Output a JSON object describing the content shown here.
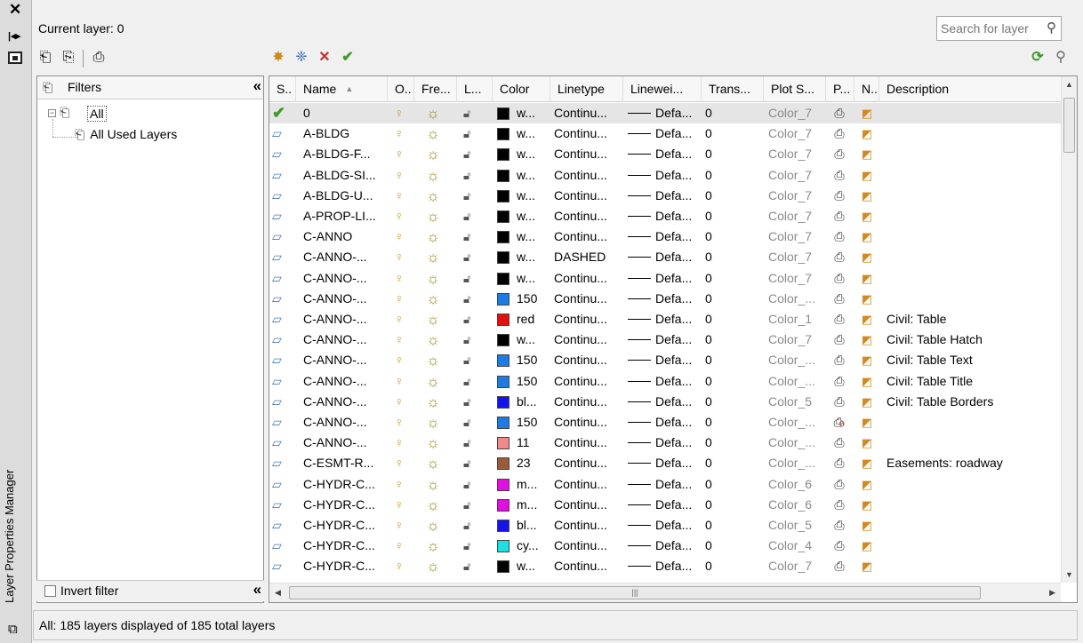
{
  "window": {
    "title": "Layer Properties Manager"
  },
  "header": {
    "current_layer": "Current layer: 0",
    "search_placeholder": "Search for layer"
  },
  "filters": {
    "title": "Filters",
    "tree": [
      {
        "label": "All"
      },
      {
        "label": "All Used Layers"
      }
    ],
    "invert_filter": "Invert filter"
  },
  "columns": [
    "S..",
    "Name",
    "O..",
    "Fre...",
    "L...",
    "Color",
    "Linetype",
    "Linewei...",
    "Trans...",
    "Plot S...",
    "P...",
    "N..",
    "Description"
  ],
  "colors": {
    "white": "#000000",
    "c150": "#1e7be0",
    "red": "#e01010",
    "blue": "#1414e6",
    "c11": "#f08a8a",
    "c23": "#9a5b3c",
    "magenta": "#e010e0",
    "cyan": "#1ee0e0"
  },
  "rows": [
    {
      "current": true,
      "name": "0",
      "swatch": "#000000",
      "color": "w...",
      "linetype": "Continu...",
      "lineweight": "Defa...",
      "trans": "0",
      "plotstyle": "Color_7",
      "print": true,
      "desc": ""
    },
    {
      "name": "A-BLDG",
      "swatch": "#000000",
      "color": "w...",
      "linetype": "Continu...",
      "lineweight": "Defa...",
      "trans": "0",
      "plotstyle": "Color_7",
      "print": true,
      "desc": ""
    },
    {
      "name": "A-BLDG-F...",
      "swatch": "#000000",
      "color": "w...",
      "linetype": "Continu...",
      "lineweight": "Defa...",
      "trans": "0",
      "plotstyle": "Color_7",
      "print": true,
      "desc": ""
    },
    {
      "name": "A-BLDG-SI...",
      "swatch": "#000000",
      "color": "w...",
      "linetype": "Continu...",
      "lineweight": "Defa...",
      "trans": "0",
      "plotstyle": "Color_7",
      "print": true,
      "desc": ""
    },
    {
      "name": "A-BLDG-U...",
      "swatch": "#000000",
      "color": "w...",
      "linetype": "Continu...",
      "lineweight": "Defa...",
      "trans": "0",
      "plotstyle": "Color_7",
      "print": true,
      "desc": ""
    },
    {
      "name": "A-PROP-LI...",
      "swatch": "#000000",
      "color": "w...",
      "linetype": "Continu...",
      "lineweight": "Defa...",
      "trans": "0",
      "plotstyle": "Color_7",
      "print": true,
      "desc": ""
    },
    {
      "name": "C-ANNO",
      "swatch": "#000000",
      "color": "w...",
      "linetype": "Continu...",
      "lineweight": "Defa...",
      "trans": "0",
      "plotstyle": "Color_7",
      "print": true,
      "desc": ""
    },
    {
      "name": "C-ANNO-...",
      "swatch": "#000000",
      "color": "w...",
      "linetype": "DASHED",
      "lineweight": "Defa...",
      "trans": "0",
      "plotstyle": "Color_7",
      "print": true,
      "desc": ""
    },
    {
      "name": "C-ANNO-...",
      "swatch": "#000000",
      "color": "w...",
      "linetype": "Continu...",
      "lineweight": "Defa...",
      "trans": "0",
      "plotstyle": "Color_7",
      "print": true,
      "desc": ""
    },
    {
      "name": "C-ANNO-...",
      "swatch": "#1e7be0",
      "color": "150",
      "linetype": "Continu...",
      "lineweight": "Defa...",
      "trans": "0",
      "plotstyle": "Color_...",
      "print": true,
      "desc": ""
    },
    {
      "name": "C-ANNO-...",
      "swatch": "#e01010",
      "color": "red",
      "linetype": "Continu...",
      "lineweight": "Defa...",
      "trans": "0",
      "plotstyle": "Color_1",
      "print": true,
      "desc": "Civil: Table"
    },
    {
      "name": "C-ANNO-...",
      "swatch": "#000000",
      "color": "w...",
      "linetype": "Continu...",
      "lineweight": "Defa...",
      "trans": "0",
      "plotstyle": "Color_7",
      "print": true,
      "desc": "Civil: Table Hatch"
    },
    {
      "name": "C-ANNO-...",
      "swatch": "#1e7be0",
      "color": "150",
      "linetype": "Continu...",
      "lineweight": "Defa...",
      "trans": "0",
      "plotstyle": "Color_...",
      "print": true,
      "desc": "Civil: Table Text"
    },
    {
      "name": "C-ANNO-...",
      "swatch": "#1e7be0",
      "color": "150",
      "linetype": "Continu...",
      "lineweight": "Defa...",
      "trans": "0",
      "plotstyle": "Color_...",
      "print": true,
      "desc": "Civil: Table Title"
    },
    {
      "name": "C-ANNO-...",
      "swatch": "#1414e6",
      "color": "bl...",
      "linetype": "Continu...",
      "lineweight": "Defa...",
      "trans": "0",
      "plotstyle": "Color_5",
      "print": true,
      "desc": "Civil: Table Borders"
    },
    {
      "name": "C-ANNO-...",
      "swatch": "#1e7be0",
      "color": "150",
      "linetype": "Continu...",
      "lineweight": "Defa...",
      "trans": "0",
      "plotstyle": "Color_...",
      "print": false,
      "desc": ""
    },
    {
      "name": "C-ANNO-...",
      "swatch": "#f08a8a",
      "color": "11",
      "linetype": "Continu...",
      "lineweight": "Defa...",
      "trans": "0",
      "plotstyle": "Color_...",
      "print": true,
      "desc": ""
    },
    {
      "name": "C-ESMT-R...",
      "swatch": "#9a5b3c",
      "color": "23",
      "linetype": "Continu...",
      "lineweight": "Defa...",
      "trans": "0",
      "plotstyle": "Color_...",
      "print": true,
      "desc": "Easements:  roadway"
    },
    {
      "name": "C-HYDR-C...",
      "swatch": "#e010e0",
      "color": "m...",
      "linetype": "Continu...",
      "lineweight": "Defa...",
      "trans": "0",
      "plotstyle": "Color_6",
      "print": true,
      "desc": ""
    },
    {
      "name": "C-HYDR-C...",
      "swatch": "#e010e0",
      "color": "m...",
      "linetype": "Continu...",
      "lineweight": "Defa...",
      "trans": "0",
      "plotstyle": "Color_6",
      "print": true,
      "desc": ""
    },
    {
      "name": "C-HYDR-C...",
      "swatch": "#1414e6",
      "color": "bl...",
      "linetype": "Continu...",
      "lineweight": "Defa...",
      "trans": "0",
      "plotstyle": "Color_5",
      "print": true,
      "desc": ""
    },
    {
      "name": "C-HYDR-C...",
      "swatch": "#1ee0e0",
      "color": "cy...",
      "linetype": "Continu...",
      "lineweight": "Defa...",
      "trans": "0",
      "plotstyle": "Color_4",
      "print": true,
      "desc": ""
    },
    {
      "name": "C-HYDR-C...",
      "swatch": "#000000",
      "color": "w...",
      "linetype": "Continu...",
      "lineweight": "Defa...",
      "trans": "0",
      "plotstyle": "Color_7",
      "print": true,
      "desc": ""
    }
  ],
  "status": "All: 185 layers displayed of 185 total layers",
  "icons": [
    "close-icon",
    "dock-icon",
    "properties-icon",
    "new-filter-icon",
    "group-filter-icon",
    "state-manager-icon",
    "new-layer-icon",
    "new-vp-frozen-layer-icon",
    "delete-layer-icon",
    "set-current-icon",
    "refresh-icon",
    "settings-icon",
    "search-icon"
  ]
}
